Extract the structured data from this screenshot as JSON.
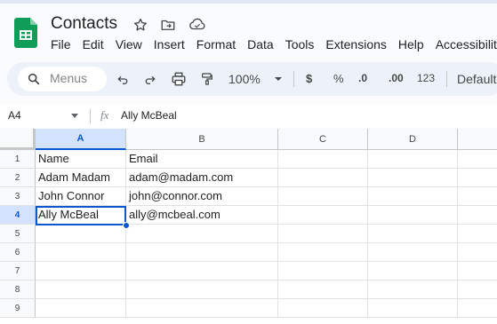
{
  "doc": {
    "title": "Contacts",
    "icons": [
      "star-icon",
      "move-to-folder-icon",
      "cloud-saved-icon"
    ]
  },
  "menu": [
    "File",
    "Edit",
    "View",
    "Insert",
    "Format",
    "Data",
    "Tools",
    "Extensions",
    "Help",
    "Accessibility"
  ],
  "toolbar": {
    "search_placeholder": "Menus",
    "zoom": "100%",
    "currency": "$",
    "percent": "%",
    "decrease_decimal": ".0",
    "increase_decimal": ".00",
    "number_format": "123",
    "font": "Default (Arial)"
  },
  "formula_bar": {
    "cell_ref": "A4",
    "fx": "fx",
    "content": "Ally McBeal"
  },
  "sheet": {
    "columns": [
      "A",
      "B",
      "C",
      "D"
    ],
    "rows": [
      "1",
      "2",
      "3",
      "4",
      "5",
      "6",
      "7",
      "8",
      "9"
    ],
    "selected_cell": "A4",
    "cells": [
      [
        "Name",
        "Email"
      ],
      [
        "Adam Madam",
        "adam@madam.com"
      ],
      [
        "John Connor",
        "john@connor.com"
      ],
      [
        "Ally McBeal",
        "ally@mcbeal.com"
      ]
    ]
  },
  "colors": {
    "brand_green": "#0f9d58",
    "selection_blue": "#0b57d0",
    "selection_header_bg": "#d3e3fd",
    "toolbar_bg": "#edf2fa"
  }
}
